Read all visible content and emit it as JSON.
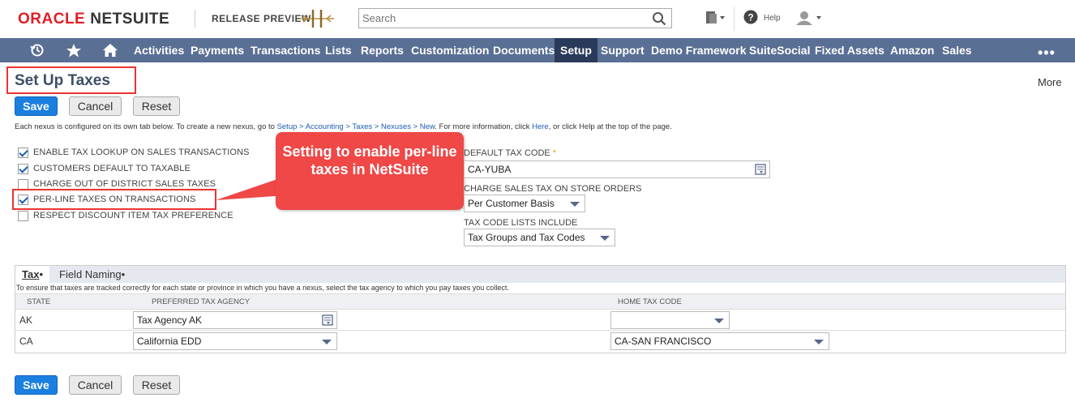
{
  "header": {
    "logo_oracle": "ORACLE",
    "logo_netsuite": "NETSUITE",
    "release_label": "RELEASE PREVIEW",
    "search_placeholder": "Search",
    "help_label": "Help"
  },
  "nav": {
    "items": [
      "Activities",
      "Payments",
      "Transactions",
      "Lists",
      "Reports",
      "Customization",
      "Documents",
      "Setup",
      "Support",
      "Demo Framework",
      "SuiteSocial",
      "Fixed Assets",
      "Amazon",
      "Sales"
    ],
    "active": "Setup",
    "more": "•••"
  },
  "page": {
    "title": "Set Up Taxes",
    "more_label": "More"
  },
  "buttons": {
    "save": "Save",
    "cancel": "Cancel",
    "reset": "Reset"
  },
  "info": {
    "part1": "Each nexus is configured on its own tab below. To create a new nexus, go to ",
    "link_path": "Setup > Accounting > Taxes > Nexuses > New",
    "part2": ". For more information, click ",
    "link_here": "Here",
    "part3": ", or click Help at the top of the page."
  },
  "checkboxes": [
    {
      "label": "ENABLE TAX LOOKUP ON SALES TRANSACTIONS",
      "checked": true
    },
    {
      "label": "CUSTOMERS DEFAULT TO TAXABLE",
      "checked": true
    },
    {
      "label": "CHARGE OUT OF DISTRICT SALES TAXES",
      "checked": false
    },
    {
      "label": "PER-LINE TAXES ON TRANSACTIONS",
      "checked": true
    },
    {
      "label": "RESPECT DISCOUNT ITEM TAX PREFERENCE",
      "checked": false
    }
  ],
  "callout": {
    "text": "Setting to enable per-line taxes in NetSuite"
  },
  "fields": {
    "default_tax_code_label": "DEFAULT TAX CODE",
    "default_tax_code_value": "CA-YUBA",
    "charge_store_label": "CHARGE SALES TAX ON STORE ORDERS",
    "charge_store_value": "Per Customer Basis",
    "tax_code_lists_label": "TAX CODE LISTS INCLUDE",
    "tax_code_lists_value": "Tax Groups and Tax Codes"
  },
  "tabs": {
    "tax_label": "Tax",
    "field_naming_label": "Field Naming",
    "description": "To ensure that taxes are tracked correctly for each state or province in which you have a nexus, select the tax agency to which you pay taxes you collect.",
    "columns": {
      "state": "STATE",
      "agency": "PREFERRED TAX AGENCY",
      "home_code": "HOME TAX CODE"
    },
    "rows": [
      {
        "state": "AK",
        "agency": "Tax Agency AK",
        "home_code": ""
      },
      {
        "state": "CA",
        "agency": "California EDD",
        "home_code": "CA-SAN FRANCISCO"
      }
    ]
  },
  "colors": {
    "nav_bg": "#5a6f94",
    "nav_active": "#2a3a5a",
    "primary_button": "#1b7fe0",
    "callout": "#f04747",
    "highlight": "#ee3333"
  }
}
